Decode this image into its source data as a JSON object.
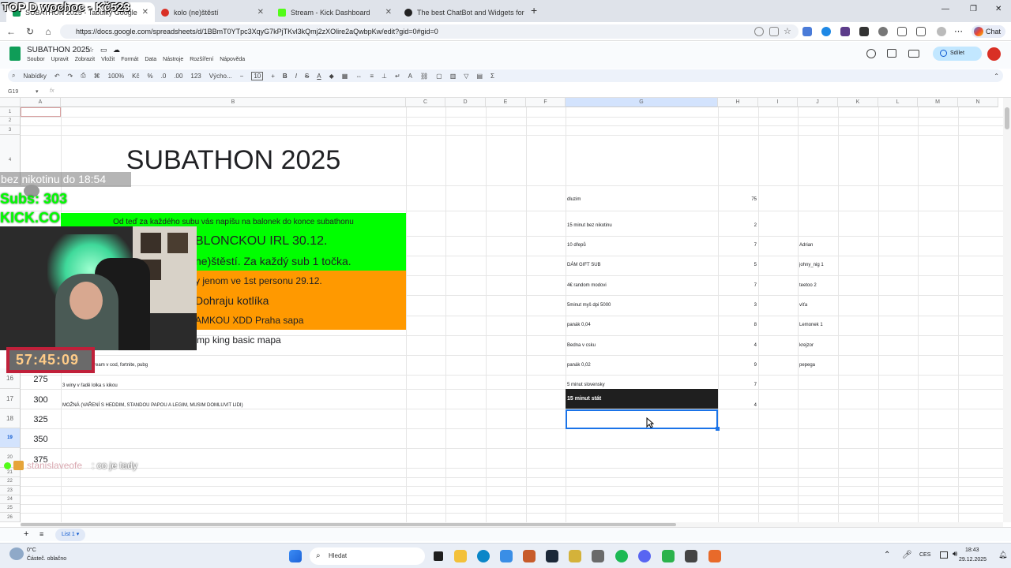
{
  "overlay": {
    "top_banner": "TOP D wochoc - Kč523",
    "nicotine_line": "bez nikotinu do 18:54",
    "subs": "Subs: 303",
    "kick": "KICK.CO",
    "timer": "57:45:09",
    "chat_user": "stanislaveofe",
    "chat_msg": ": co je tady"
  },
  "browser": {
    "tabs": [
      {
        "label": "SUBATHON 2025 - Tabulky Google",
        "active": true
      },
      {
        "label": "kolo (ne)štěstí",
        "active": false
      },
      {
        "label": "Stream - Kick Dashboard",
        "active": false
      },
      {
        "label": "The best ChatBot and Widgets for",
        "active": false
      }
    ],
    "new_tab": "+",
    "url": "https://docs.google.com/spreadsheets/d/1BBmT0YTpc3XqyG7kPjTKvl3kQmj2zXOlire2aQwbpKw/edit?gid=0#gid=0",
    "chat_button": "Chat",
    "colors": {
      "accent": "#0b57d0",
      "green": "#00ff00",
      "orange": "#ff9900"
    }
  },
  "sheet": {
    "title": "SUBATHON 2025",
    "menus": [
      "Soubor",
      "Upravit",
      "Zobrazit",
      "Vložit",
      "Formát",
      "Data",
      "Nástroje",
      "Rozšíření",
      "Nápověda"
    ],
    "share_label": "Sdílet",
    "toolbar": {
      "search": "Nabídky",
      "zoom": "100%",
      "currency": "Kč",
      "percent": "%",
      "font": "Výcho...",
      "font_size": "10"
    },
    "name_box": "G19",
    "fx": "fx",
    "columns": [
      "A",
      "B",
      "C",
      "D",
      "E",
      "F",
      "G",
      "H",
      "I",
      "J",
      "K",
      "L",
      "M",
      "N"
    ],
    "header_big": "SUBATHON 2025",
    "b_rows": [
      "Od teď za každého subu vás napíšu na balonek do konce subathonu",
      "BLONCKOU IRL 30.12.",
      "ne)štěstí. Za každý sub 1 točka.",
      "y jenom ve 1st personu 29.12.",
      "Dohraju kotlíka",
      "AMKOU XDD Praha sapa",
      "mp king basic mapa",
      "Wither jeden stream v cod, fortnite, pubg",
      "3 winy v řadě lolka s kikou",
      "MOŽNÁ (VAŘENÍ S HEDDIM, STANDOU PAPOU A LEGIM, MUSIM DOMLUVIT LIDI)"
    ],
    "a_values": [
      "275",
      "300",
      "325",
      "350",
      "375"
    ],
    "row_numbers": [
      "1",
      "2",
      "3",
      "4",
      "5",
      "6",
      "7",
      "8",
      "9",
      "10",
      "11",
      "12",
      "13",
      "14",
      "15",
      "16",
      "17",
      "18",
      "19",
      "20",
      "21",
      "22",
      "23",
      "24",
      "25",
      "26",
      "27"
    ],
    "g_items": [
      {
        "label": "dluzim",
        "value": "75",
        "person": ""
      },
      {
        "label": "15 minut bez nikotinu",
        "value": "2",
        "person": ""
      },
      {
        "label": "10 dřepů",
        "value": "7",
        "person": "Adrian"
      },
      {
        "label": "DÁM GIFT SUB",
        "value": "5",
        "person": "johny_nig 1"
      },
      {
        "label": "4€ random modovi",
        "value": "7",
        "person": "teetoo 2"
      },
      {
        "label": "5minut myš dpi 5000",
        "value": "3",
        "person": "víťa"
      },
      {
        "label": "panák 0,04",
        "value": "8",
        "person": "Lemonek 1"
      },
      {
        "label": "Bedna v csku",
        "value": "4",
        "person": "krejzor"
      },
      {
        "label": "panák 0,02",
        "value": "9",
        "person": "pepega"
      },
      {
        "label": "5 minut slovensky",
        "value": "7",
        "person": ""
      },
      {
        "label": "15 minut stát",
        "value": "4",
        "person": ""
      }
    ],
    "sheet_tab": "List 1"
  },
  "taskbar": {
    "weather_temp": "0°C",
    "weather_desc": "Částeč. oblačno",
    "search": "Hledat",
    "lang": "CES",
    "time": "18:43",
    "date": "29.12.2025"
  }
}
